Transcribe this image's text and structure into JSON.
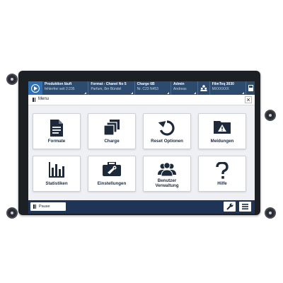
{
  "status_bar": {
    "segments": [
      {
        "title": "Produktion läuft",
        "subtitle": "fehlerfrei seit 2:235"
      },
      {
        "title": "Format - Chanel No 5",
        "subtitle": "Parfum, 8er Bündel"
      },
      {
        "title": "Charge 6B",
        "subtitle": "Nr. C23 N453"
      },
      {
        "title": "Admin",
        "subtitle": "Andreas"
      },
      {
        "title": "FilmTeq 3030",
        "subtitle": "MXXXXXX"
      }
    ]
  },
  "menu": {
    "label": "Menu",
    "close": "×"
  },
  "tiles": [
    {
      "label": "Formate",
      "icon": "document-icon"
    },
    {
      "label": "Charge",
      "icon": "stack-icon"
    },
    {
      "label": "Reset Optionen",
      "icon": "reset-icon"
    },
    {
      "label": "Meldungen",
      "icon": "warning-folder-icon"
    },
    {
      "label": "Statistiken",
      "icon": "bar-chart-icon"
    },
    {
      "label": "Einstellungen",
      "icon": "toolbox-icon"
    },
    {
      "label_line1": "Benutzer",
      "label_line2": "Verwaltung",
      "icon": "users-icon"
    },
    {
      "label": "Hilfe",
      "icon": "question-icon"
    }
  ],
  "bottom_bar": {
    "pause_label": "Pause"
  },
  "colors": {
    "accent": "#2f6fb4",
    "header": "#2d4a6f",
    "footer": "#1e3557"
  }
}
